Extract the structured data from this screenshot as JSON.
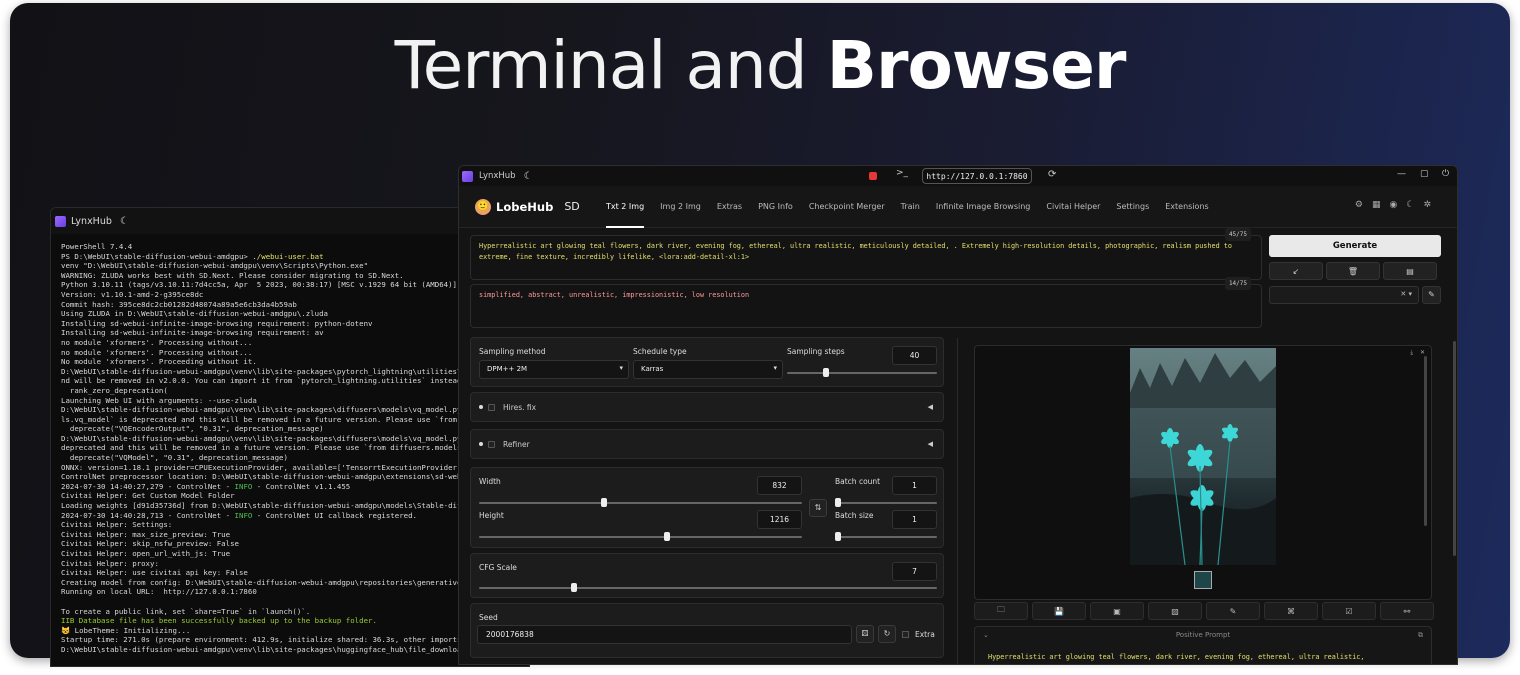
{
  "headline": {
    "light": "Terminal",
    "mid": "and",
    "bold": "Browser"
  },
  "terminal": {
    "app_name": "LynxHub",
    "lines": [
      {
        "t": "PowerShell 7.4.4",
        "c": ""
      },
      {
        "t": "PS D:\\WebUI\\stable-diffusion-webui-amdgpu> ./webui-user.bat",
        "c": ""
      },
      {
        "t": "venv \"D:\\WebUI\\stable-diffusion-webui-amdgpu\\venv\\Scripts\\Python.exe\"",
        "c": ""
      },
      {
        "t": "WARNING: ZLUDA works best with SD.Next. Please consider migrating to SD.Next.",
        "c": ""
      },
      {
        "t": "Python 3.10.11 (tags/v3.10.11:7d4cc5a, Apr  5 2023, 00:38:17) [MSC v.1929 64 bit (AMD64)]",
        "c": ""
      },
      {
        "t": "Version: v1.10.1-amd-2-g395ce8dc",
        "c": ""
      },
      {
        "t": "Commit hash: 395ce8dc2cb01282d48074a89a5e6cb3da4b59ab",
        "c": ""
      },
      {
        "t": "Using ZLUDA in D:\\WebUI\\stable-diffusion-webui-amdgpu\\.zluda",
        "c": ""
      },
      {
        "t": "Installing sd-webui-infinite-image-browsing requirement: python-dotenv",
        "c": ""
      },
      {
        "t": "Installing sd-webui-infinite-image-browsing requirement: av",
        "c": ""
      },
      {
        "t": "no module 'xformers'. Processing without...",
        "c": ""
      },
      {
        "t": "no module 'xformers'. Processing without...",
        "c": ""
      },
      {
        "t": "No module 'xformers'. Proceeding without it.",
        "c": ""
      },
      {
        "t": "D:\\WebUI\\stable-diffusion-webui-amdgpu\\venv\\lib\\site-packages\\pytorch_lightning\\utilities\\d",
        "c": ""
      },
      {
        "t": "nd will be removed in v2.0.0. You can import it from `pytorch_lightning.utilities` instead",
        "c": ""
      },
      {
        "t": "  rank_zero_deprecation(",
        "c": ""
      },
      {
        "t": "Launching Web UI with arguments: --use-zluda",
        "c": ""
      },
      {
        "t": "D:\\WebUI\\stable-diffusion-webui-amdgpu\\venv\\lib\\site-packages\\diffusers\\models\\vq_model.py",
        "c": ""
      },
      {
        "t": "ls.vq_model` is deprecated and this will be removed in a future version. Please use `from d",
        "c": ""
      },
      {
        "t": "  deprecate(\"VQEncoderOutput\", \"0.31\", deprecation_message)",
        "c": ""
      },
      {
        "t": "D:\\WebUI\\stable-diffusion-webui-amdgpu\\venv\\lib\\site-packages\\diffusers\\models\\vq_model.py",
        "c": ""
      },
      {
        "t": "deprecated and this will be removed in a future version. Please use `from diffusers.models",
        "c": ""
      },
      {
        "t": "  deprecate(\"VQModel\", \"0.31\", deprecation_message)",
        "c": ""
      },
      {
        "t": "ONNX: version=1.18.1 provider=CPUExecutionProvider, available=['TensorrtExecutionProvider'",
        "c": ""
      },
      {
        "t": "ControlNet preprocessor location: D:\\WebUI\\stable-diffusion-webui-amdgpu\\extensions\\sd-webu",
        "c": ""
      },
      {
        "t": "2024-07-30 14:40:27,279 - ControlNet - INFO - ControlNet v1.1.455",
        "c": "info"
      },
      {
        "t": "Civitai Helper: Get Custom Model Folder",
        "c": ""
      },
      {
        "t": "Loading weights [d91d35736d] from D:\\WebUI\\stable-diffusion-webui-amdgpu\\models\\Stable-dif",
        "c": ""
      },
      {
        "t": "2024-07-30 14:40:28,713 - ControlNet - INFO - ControlNet UI callback registered.",
        "c": "info"
      },
      {
        "t": "Civitai Helper: Settings:",
        "c": ""
      },
      {
        "t": "Civitai Helper: max_size_preview: True",
        "c": ""
      },
      {
        "t": "Civitai Helper: skip_nsfw_preview: False",
        "c": ""
      },
      {
        "t": "Civitai Helper: open_url_with_js: True",
        "c": ""
      },
      {
        "t": "Civitai Helper: proxy:",
        "c": ""
      },
      {
        "t": "Civitai Helper: use civitai api key: False",
        "c": ""
      },
      {
        "t": "Creating model from config: D:\\WebUI\\stable-diffusion-webui-amdgpu\\repositories\\generative",
        "c": ""
      },
      {
        "t": "Running on local URL:  http://127.0.0.1:7860",
        "c": ""
      },
      {
        "t": "",
        "c": ""
      },
      {
        "t": "To create a public link, set `share=True` in `launch()`.",
        "c": ""
      },
      {
        "t": "IIB Database file has been successfully backed up to the backup folder.",
        "c": "g"
      },
      {
        "t": "😺 LobeTheme: Initializing...",
        "c": ""
      },
      {
        "t": "Startup time: 271.0s (prepare environment: 412.9s, initialize shared: 36.3s, other imports",
        "c": ""
      },
      {
        "t": "D:\\WebUI\\stable-diffusion-webui-amdgpu\\venv\\lib\\site-packages\\huggingface_hub\\file_downloa",
        "c": ""
      }
    ]
  },
  "browser": {
    "app_name": "LynxHub",
    "url": "http://127.0.0.1:7860",
    "brand": "LobeHub",
    "brand_suffix": "SD",
    "tabs": [
      "Txt 2 Img",
      "Img 2 Img",
      "Extras",
      "PNG Info",
      "Checkpoint Merger",
      "Train",
      "Infinite Image Browsing",
      "Civitai Helper",
      "Settings",
      "Extensions"
    ],
    "active_tab": "Txt 2 Img",
    "prompt": {
      "positive": "Hyperrealistic art glowing teal flowers, dark river, evening fog, ethereal, ultra realistic, meticulously detailed, . Extremely high-resolution details, photographic, realism pushed to extreme, fine texture, incredibly lifelike, <lora:add-detail-xl:1>",
      "positive_count": "45/75",
      "negative": "simplified, abstract, unrealistic, impressionistic, low resolution",
      "negative_count": "14/75"
    },
    "generate_label": "Generate",
    "sampling": {
      "method_label": "Sampling method",
      "method_value": "DPM++ 2M",
      "schedule_label": "Schedule type",
      "schedule_value": "Karras",
      "steps_label": "Sampling steps",
      "steps_value": "40",
      "steps_min": 1,
      "steps_max": 150
    },
    "hires_label": "Hires. fix",
    "refiner_label": "Refiner",
    "size": {
      "width_label": "Width",
      "width_value": "832",
      "height_label": "Height",
      "height_value": "1216",
      "batch_count_label": "Batch count",
      "batch_count_value": "1",
      "batch_size_label": "Batch size",
      "batch_size_value": "1",
      "min": 64,
      "max": 2048
    },
    "cfg": {
      "label": "CFG Scale",
      "value": "7",
      "min": 1,
      "max": 30
    },
    "seed": {
      "label": "Seed",
      "value": "2000176838",
      "extra_label": "Extra"
    },
    "output": {
      "positive_prompt_header": "Positive Prompt",
      "positive_prompt_preview": "Hyperrealistic art glowing teal flowers, dark river, evening fog, ethereal, ultra realistic,"
    },
    "colors": {
      "accent_prompt": "#e5e06a",
      "negative_prompt": "#ff9a9a",
      "record": "#e53935"
    }
  }
}
